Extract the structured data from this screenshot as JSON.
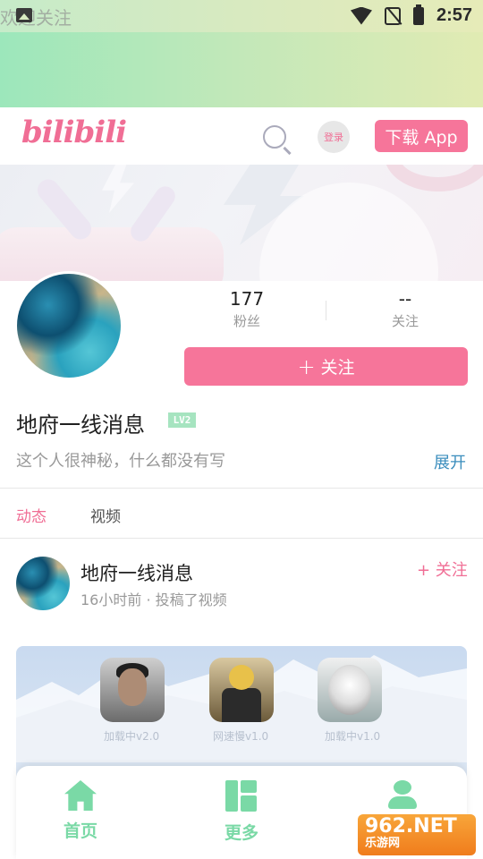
{
  "status_bar": {
    "title": "欢迎关注",
    "time": "2:57"
  },
  "header": {
    "logo": "bilibili",
    "login_label": "登录",
    "download_label": "下载 App"
  },
  "profile": {
    "stats": {
      "fans_value": "177",
      "fans_label": "粉丝",
      "follow_value": "--",
      "follow_label": "关注"
    },
    "follow_label": "关注",
    "follow_plus": "+",
    "username": "地府一线消息",
    "level": "LV2",
    "bio": "这个人很神秘，什么都没有写",
    "expand_label": "展开"
  },
  "tabs": [
    {
      "label": "动态"
    },
    {
      "label": "视频"
    }
  ],
  "post": {
    "author": "地府一线消息",
    "meta": "16小时前 · 投稿了视频",
    "follow_label": "+ 关注",
    "thumbnail_captions": [
      "加载中v2.0",
      "网速慢v1.0",
      "加载中v1.0"
    ]
  },
  "bottom_nav": [
    {
      "label": "首页",
      "icon": "home-icon"
    },
    {
      "label": "更多",
      "icon": "grid-icon"
    },
    {
      "label": "",
      "icon": "person-icon"
    }
  ],
  "watermark": {
    "text": "962.NET",
    "sub": "乐游网"
  },
  "colors": {
    "brand_pink": "#f6759a",
    "nav_green": "#7ad9a6",
    "link_blue": "#3a8dbd"
  }
}
